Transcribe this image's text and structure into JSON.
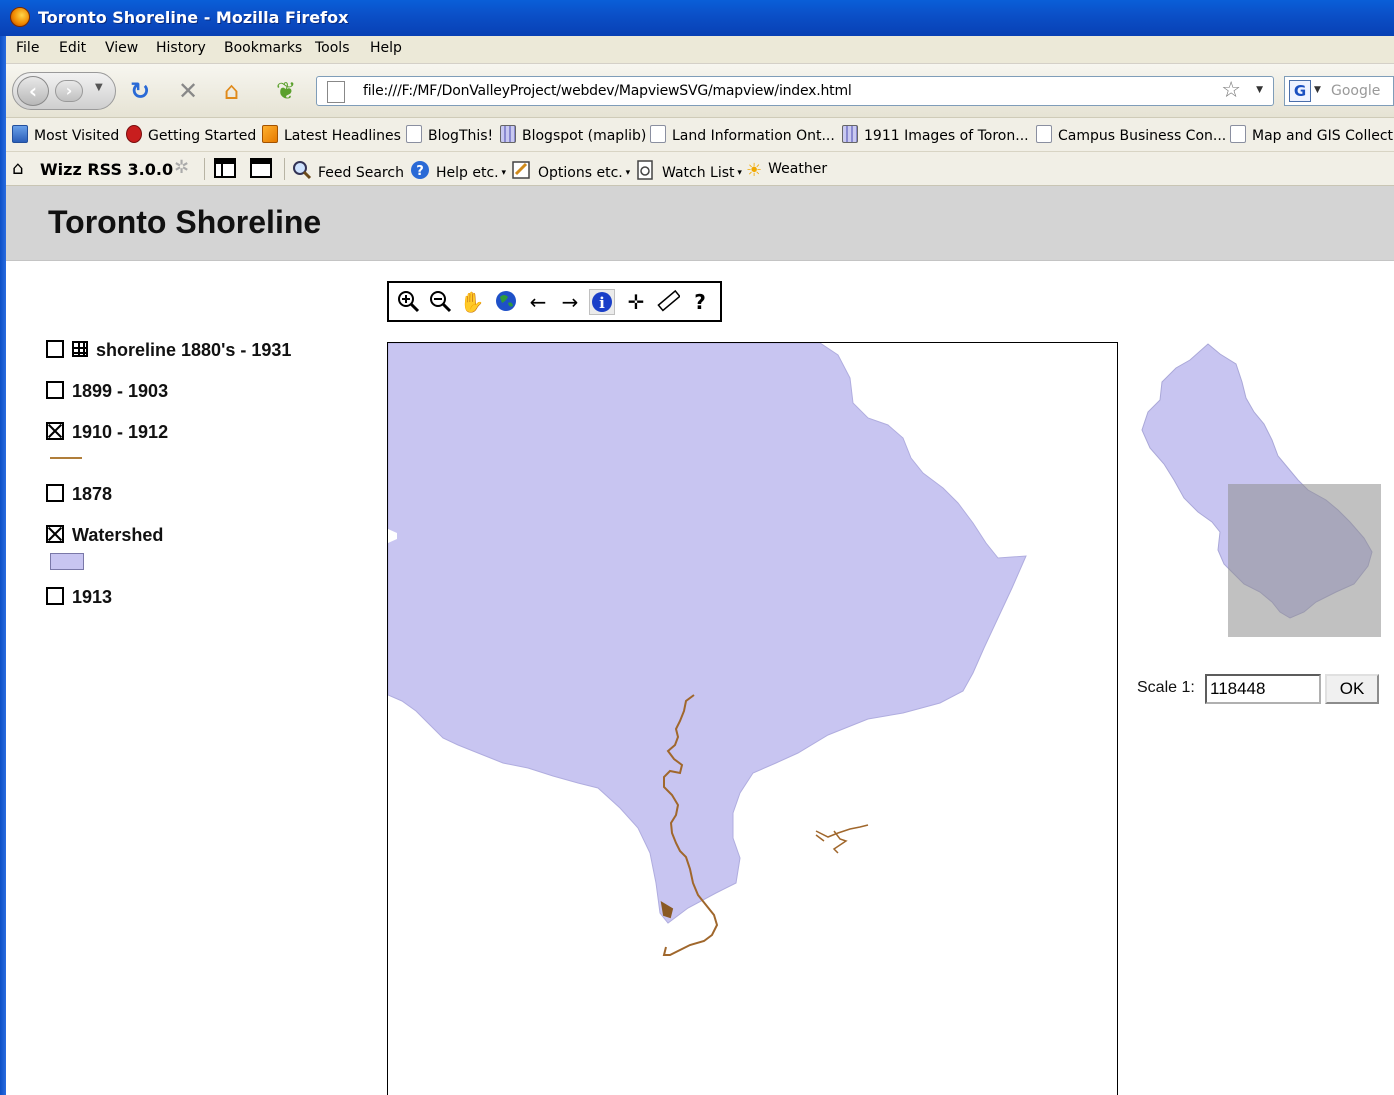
{
  "window": {
    "title": "Toronto Shoreline - Mozilla Firefox"
  },
  "menu": [
    "File",
    "Edit",
    "View",
    "History",
    "Bookmarks",
    "Tools",
    "Help"
  ],
  "nav": {
    "url": "file:///F:/MF/DonValleyProject/webdev/MapviewSVG/mapview/index.html",
    "search_placeholder": "Google"
  },
  "bookmarks": [
    "Most Visited",
    "Getting Started",
    "Latest Headlines",
    "BlogThis!",
    "Blogspot (maplib)",
    "Land Information Ont...",
    "1911 Images of Toron...",
    "Campus Business Con...",
    "Map and GIS Collectio"
  ],
  "wizz": {
    "title": "Wizz RSS 3.0.0",
    "feed_search": "Feed Search",
    "help": "Help etc.",
    "options": "Options etc.",
    "watch_list": "Watch List",
    "weather": "Weather"
  },
  "page": {
    "title": "Toronto Shoreline"
  },
  "legend": [
    {
      "label": "shoreline 1880's - 1931",
      "checked": false
    },
    {
      "label": "1899 - 1903",
      "checked": false
    },
    {
      "label": "1910 - 1912",
      "checked": true
    },
    {
      "label": "1878",
      "checked": false
    },
    {
      "label": "Watershed",
      "checked": true
    },
    {
      "label": "1913",
      "checked": false
    }
  ],
  "colors": {
    "watershed_fill": "#c8c5f1",
    "shoreline_1910": "#a0672c",
    "overview_extent": "#8e8e8e"
  },
  "tools": [
    "zoom-in",
    "zoom-out",
    "pan",
    "full-extent",
    "back",
    "forward",
    "info",
    "center",
    "measure",
    "help"
  ],
  "scale": {
    "label": "Scale 1:",
    "value": "118448",
    "ok": "OK"
  }
}
